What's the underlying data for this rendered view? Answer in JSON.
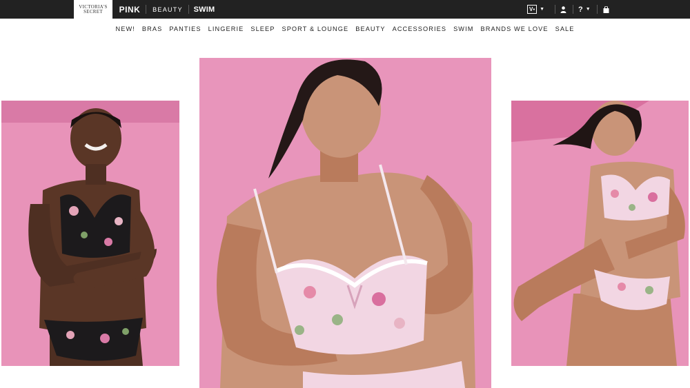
{
  "topbar": {
    "brands": [
      {
        "label_line1": "VICTORIA'S",
        "label_line2": "SECRET"
      },
      {
        "label": "PINK"
      },
      {
        "label": "BEAUTY"
      },
      {
        "label": "SWIM"
      }
    ],
    "utilities": {
      "card_badge": "V▪",
      "help_label": "?"
    }
  },
  "nav": {
    "items": [
      "NEW!",
      "BRAS",
      "PANTIES",
      "LINGERIE",
      "SLEEP",
      "SPORT & LOUNGE",
      "BEAUTY",
      "ACCESSORIES",
      "SWIM",
      "BRANDS WE LOVE",
      "SALE"
    ]
  },
  "colors": {
    "topbar_bg": "#222222",
    "backdrop_pink": "#e58fb6",
    "backdrop_pink_dark": "#d96f9e",
    "skin_dark": "#5a3626",
    "skin_medium": "#b97b5c",
    "skin_light": "#c99478",
    "lingerie_black": "#1c1a1c",
    "lingerie_pink": "#f2d6e3"
  },
  "icons": {
    "account": "person-icon",
    "bag": "shopping-bag-icon",
    "chevron": "chevron-down-icon"
  }
}
